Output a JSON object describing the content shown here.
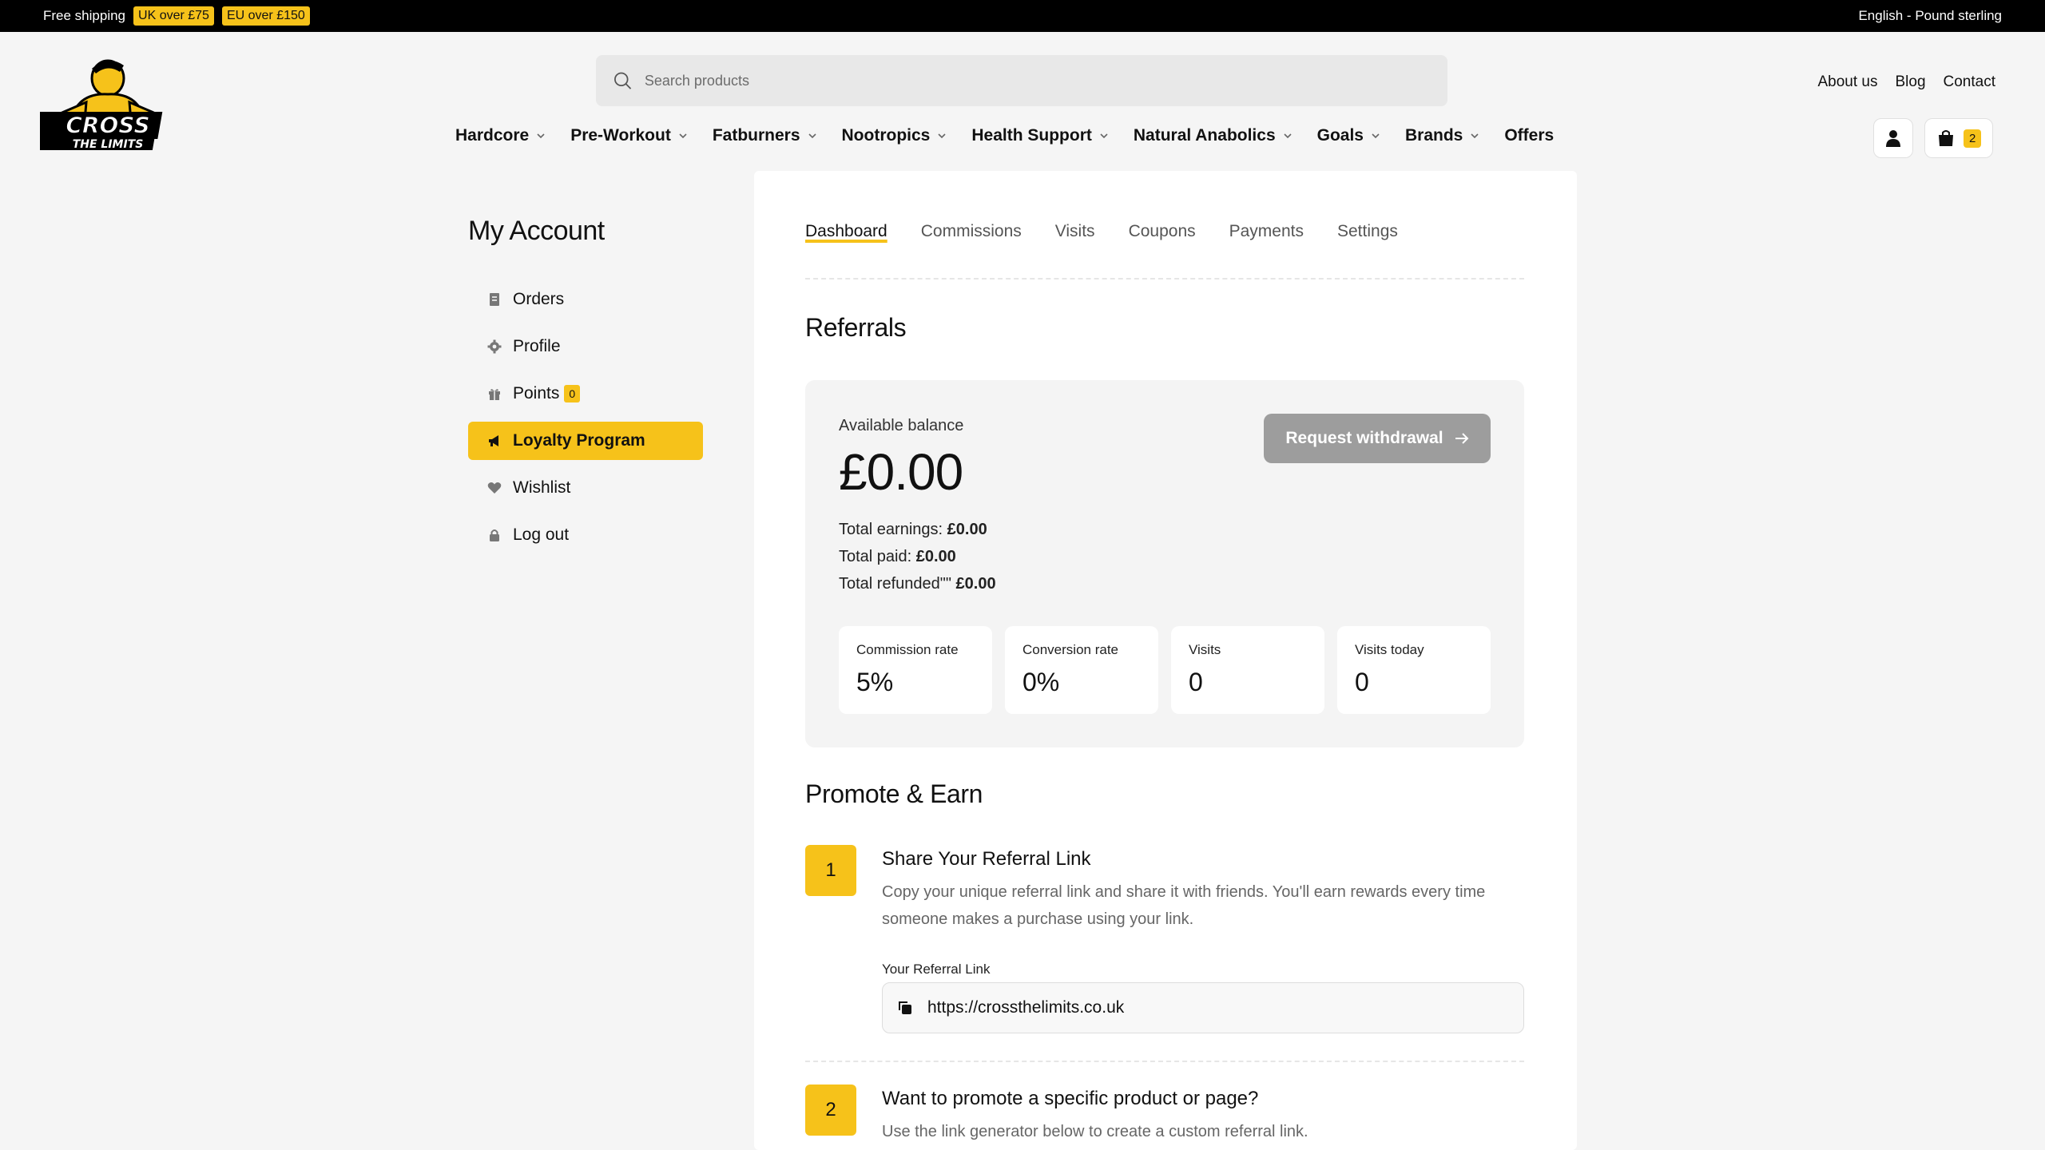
{
  "promo": {
    "free_shipping": "Free shipping",
    "uk_badge": "UK over £75",
    "eu_badge": "EU over £150",
    "locale": "English - Pound sterling"
  },
  "header": {
    "logo_text_top": "CROSS",
    "logo_text_bottom": "THE LIMITS",
    "search_placeholder": "Search products",
    "top_links": [
      "About us",
      "Blog",
      "Contact"
    ],
    "nav": [
      "Hardcore",
      "Pre-Workout",
      "Fatburners",
      "Nootropics",
      "Health Support",
      "Natural Anabolics",
      "Goals",
      "Brands",
      "Offers"
    ],
    "cart_count": "2"
  },
  "sidebar": {
    "title": "My Account",
    "items": [
      {
        "label": "Orders",
        "icon": "receipt-icon"
      },
      {
        "label": "Profile",
        "icon": "gear-icon"
      },
      {
        "label": "Points",
        "icon": "gift-icon",
        "badge": "0"
      },
      {
        "label": "Loyalty Program",
        "icon": "megaphone-icon"
      },
      {
        "label": "Wishlist",
        "icon": "heart-icon"
      },
      {
        "label": "Log out",
        "icon": "lock-icon"
      }
    ]
  },
  "tabs": [
    "Dashboard",
    "Commissions",
    "Visits",
    "Coupons",
    "Payments",
    "Settings"
  ],
  "referrals": {
    "title": "Referrals",
    "available_label": "Available balance",
    "balance": "£0.00",
    "total_earnings_label": "Total earnings:",
    "total_earnings": "£0.00",
    "total_paid_label": "Total paid:",
    "total_paid": "£0.00",
    "total_refunded_label": "Total refunded\"\"",
    "total_refunded": "£0.00",
    "withdraw_button": "Request withdrawal",
    "stats": [
      {
        "label": "Commission rate",
        "value": "5%"
      },
      {
        "label": "Conversion rate",
        "value": "0%"
      },
      {
        "label": "Visits",
        "value": "0"
      },
      {
        "label": "Visits today",
        "value": "0"
      }
    ]
  },
  "promote": {
    "title": "Promote & Earn",
    "step1": {
      "num": "1",
      "title": "Share Your Referral Link",
      "desc": "Copy your unique referral link and share it with friends. You'll earn rewards every time someone makes a purchase using your link.",
      "link_label": "Your Referral Link",
      "link": "https://crossthelimits.co.uk"
    },
    "step2": {
      "num": "2",
      "title": "Want to promote a specific product or page?",
      "desc": "Use the link generator below to create a custom referral link."
    }
  },
  "colors": {
    "accent": "#f6c21a",
    "button_disabled": "#9d9d9d"
  }
}
